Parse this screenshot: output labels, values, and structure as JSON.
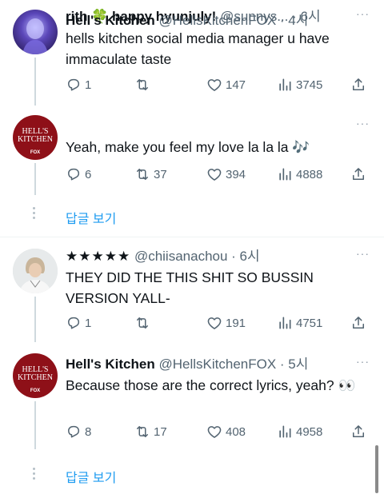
{
  "tweets": [
    {
      "name": "rith 🍀 happy hyunjuly!",
      "handle": "@sunnys...",
      "time": "· 6시",
      "text": "hells kitchen social media manager u have immaculate taste",
      "replies": "1",
      "retweets": "",
      "likes": "147",
      "views": "3745"
    },
    {
      "name": "Hell's Kitchen",
      "handle": "@HellsKitchenFOX",
      "time": "· 4시",
      "text": "Yeah, make you feel my love la la la 🎶",
      "replies": "6",
      "retweets": "37",
      "likes": "394",
      "views": "4888",
      "show_replies": "답글 보기",
      "avatar_text": [
        "HELL'S",
        "KITCHEN",
        "FOX"
      ]
    },
    {
      "name": "★★★★★",
      "handle": "@chiisanachou",
      "time": "· 6시",
      "text": "THEY DID THE THIS SHIT SO BUSSIN VERSION YALL-",
      "replies": "1",
      "retweets": "",
      "likes": "191",
      "views": "4751"
    },
    {
      "name": "Hell's Kitchen",
      "handle": "@HellsKitchenFOX",
      "time": "· 5시",
      "text": "Because those are the correct lyrics, yeah? 👀",
      "replies": "8",
      "retweets": "17",
      "likes": "408",
      "views": "4958",
      "show_replies": "답글 보기",
      "avatar_text": [
        "HELL'S",
        "KITCHEN",
        "FOX"
      ]
    }
  ],
  "more_glyph": "···",
  "icons": [
    "reply-icon",
    "retweet-icon",
    "like-icon",
    "views-icon",
    "share-icon",
    "more-icon"
  ],
  "colors": {
    "link": "#1d9bf0",
    "muted": "#536471",
    "hk_red": "#a1121b"
  }
}
